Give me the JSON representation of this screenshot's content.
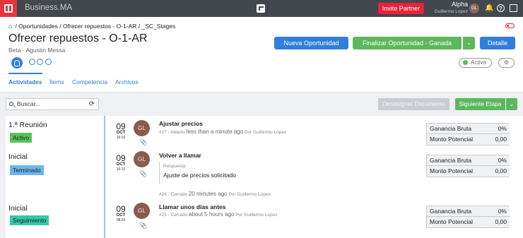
{
  "app": {
    "name": "Business.MA",
    "invite_label": "Invite Partner",
    "user_name": "Alpha",
    "user_sub": "Guillermo Lopez",
    "user_initials": "GL"
  },
  "breadcrumb": {
    "part1": "Oportunidades",
    "part2": "Ofrecer repuestos - O-1-AR",
    "part3": "_SC_Stages"
  },
  "header": {
    "title": "Ofrecer repuestos - O-1-AR",
    "subtitle": "Beta - Agustin Messa",
    "btn_nueva": "Nueva Oportunidad",
    "btn_finalizar": "Finalizar Oportunidad - Ganada",
    "btn_detalle": "Detalle",
    "status": "Activo"
  },
  "tabs": [
    "Actividades",
    "Ítems",
    "Competencia",
    "Archivos"
  ],
  "toolbar": {
    "search_placeholder": "Buscar...",
    "desasignar": "Desasignar Documento",
    "siguiente": "Siguiente Etapa"
  },
  "activities": [
    {
      "stage": "1.ª Reunión",
      "badge": "Activo",
      "day": "09",
      "month": "OCT",
      "time": "16:10",
      "initials": "GL",
      "title": "Ajustar precios",
      "meta_pre": "#27 - Abierto",
      "meta_when": "less than a minute ago",
      "meta_by": "Por Guillermo Lopez",
      "money_label1": "Ganancia Bruta",
      "money_val1": "0%",
      "money_label2": "Monto Potencial",
      "money_val2": "0,00"
    },
    {
      "stage": "Inicial",
      "badge": "Terminado",
      "day": "09",
      "month": "OCT",
      "time": "16:10",
      "initials": "GL",
      "title": "Volver a llamar",
      "reply_label": "Respuesta",
      "reply_text": "Ajuste de precios solicitado",
      "meta_pre": "#26 - Cerrado",
      "meta_when": "20 minutes ago",
      "meta_by": "Por Guillermo Lopez",
      "money_label1": "Ganancia Bruta",
      "money_val1": "0%",
      "money_label2": "Monto Potencial",
      "money_val2": "0,00"
    },
    {
      "stage": "Inicial",
      "badge": "Seguimiento",
      "day": "09",
      "month": "OCT",
      "time": "08:25",
      "initials": "GL",
      "title": "Llamar unos días antes",
      "meta_pre": "#25 - Cerrado",
      "meta_when": "about 5 hours ago",
      "meta_by": "Por Guillermo Lopez",
      "money_label1": "Ganancia Bruta",
      "money_val1": "0%",
      "money_label2": "Monto Potencial",
      "money_val2": "0,00"
    }
  ]
}
